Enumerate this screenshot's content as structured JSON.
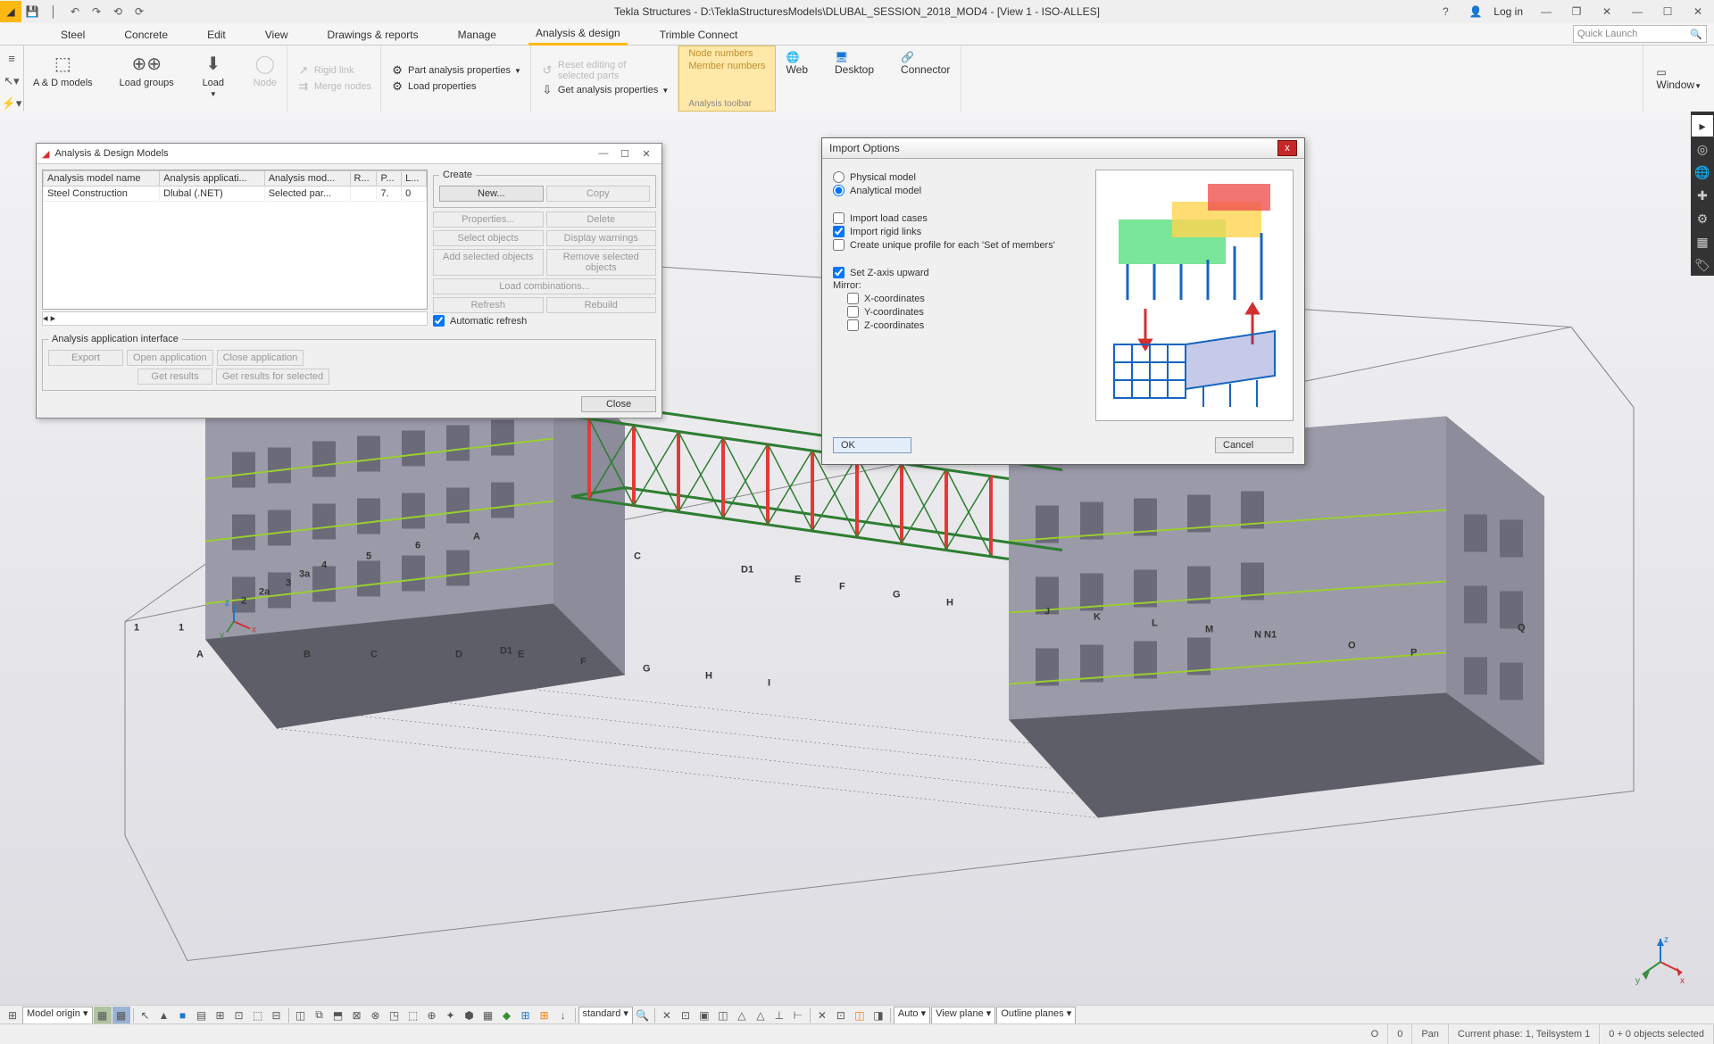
{
  "titlebar": {
    "title": "Tekla Structures - D:\\TeklaStructuresModels\\DLUBAL_SESSION_2018_MOD4 - [View 1 - ISO-ALLES]",
    "login": "Log in"
  },
  "menubar": {
    "items": [
      "Steel",
      "Concrete",
      "Edit",
      "View",
      "Drawings & reports",
      "Manage",
      "Analysis & design",
      "Trimble Connect"
    ],
    "active": "Analysis & design",
    "quick_launch_placeholder": "Quick Launch"
  },
  "ribbon": {
    "ad_models": "A & D models",
    "load_groups": "Load groups",
    "load": "Load",
    "node": "Node",
    "rigid_link": "Rigid link",
    "merge_nodes": "Merge nodes",
    "part_analysis": "Part analysis properties",
    "reset_editing": "Reset editing of selected parts",
    "load_properties": "Load properties",
    "get_analysis": "Get analysis properties",
    "node_numbers": "Node numbers",
    "member_numbers": "Member numbers",
    "analysis_toolbar": "Analysis toolbar",
    "web": "Web",
    "desktop": "Desktop",
    "connector": "Connector",
    "window": "Window"
  },
  "ad_dialog": {
    "title": "Analysis & Design Models",
    "cols": [
      "Analysis model name",
      "Analysis applicati...",
      "Analysis mod...",
      "R...",
      "P...",
      "L..."
    ],
    "row": {
      "name": "Steel Construction",
      "app": "Dlubal (.NET)",
      "mod": "Selected par...",
      "r": "",
      "p": "7.",
      "l": "0"
    },
    "create": "Create",
    "new": "New...",
    "copy": "Copy",
    "properties": "Properties...",
    "delete": "Delete",
    "select_objects": "Select objects",
    "display_warnings": "Display warnings",
    "add_selected": "Add selected objects",
    "remove_selected": "Remove selected objects",
    "load_comb": "Load combinations...",
    "refresh": "Refresh",
    "rebuild": "Rebuild",
    "auto_refresh": "Automatic refresh",
    "app_iface": "Analysis application interface",
    "export": "Export",
    "open_app": "Open application",
    "close_app": "Close application",
    "get_results": "Get results",
    "get_results_sel": "Get results for selected",
    "close": "Close"
  },
  "import_dialog": {
    "title": "Import Options",
    "physical": "Physical model",
    "analytical": "Analytical model",
    "import_load_cases": "Import load cases",
    "import_rigid_links": "Import rigid links",
    "create_unique": "Create unique profile for each 'Set of members'",
    "set_z": "Set Z-axis upward",
    "mirror": "Mirror:",
    "xcoord": "X-coordinates",
    "ycoord": "Y-coordinates",
    "zcoord": "Z-coordinates",
    "ok": "OK",
    "cancel": "Cancel"
  },
  "bottom_toolbar": {
    "model_origin": "Model origin",
    "standard": "standard",
    "auto": "Auto",
    "view_plane": "View plane",
    "outline_planes": "Outline planes"
  },
  "statusbar": {
    "o": "O",
    "zero": "0",
    "pan": "Pan",
    "phase": "Current phase: 1, Teilsystem 1",
    "selection": "0 + 0 objects selected"
  },
  "grid_labels": [
    "1",
    "2",
    "2a",
    "3",
    "3a",
    "4",
    "5",
    "6",
    "A",
    "A",
    "B",
    "C",
    "D",
    "D1",
    "E",
    "F",
    "G",
    "H",
    "I",
    "J",
    "K",
    "L",
    "M",
    "N",
    "N1",
    "O",
    "P",
    "Q"
  ]
}
